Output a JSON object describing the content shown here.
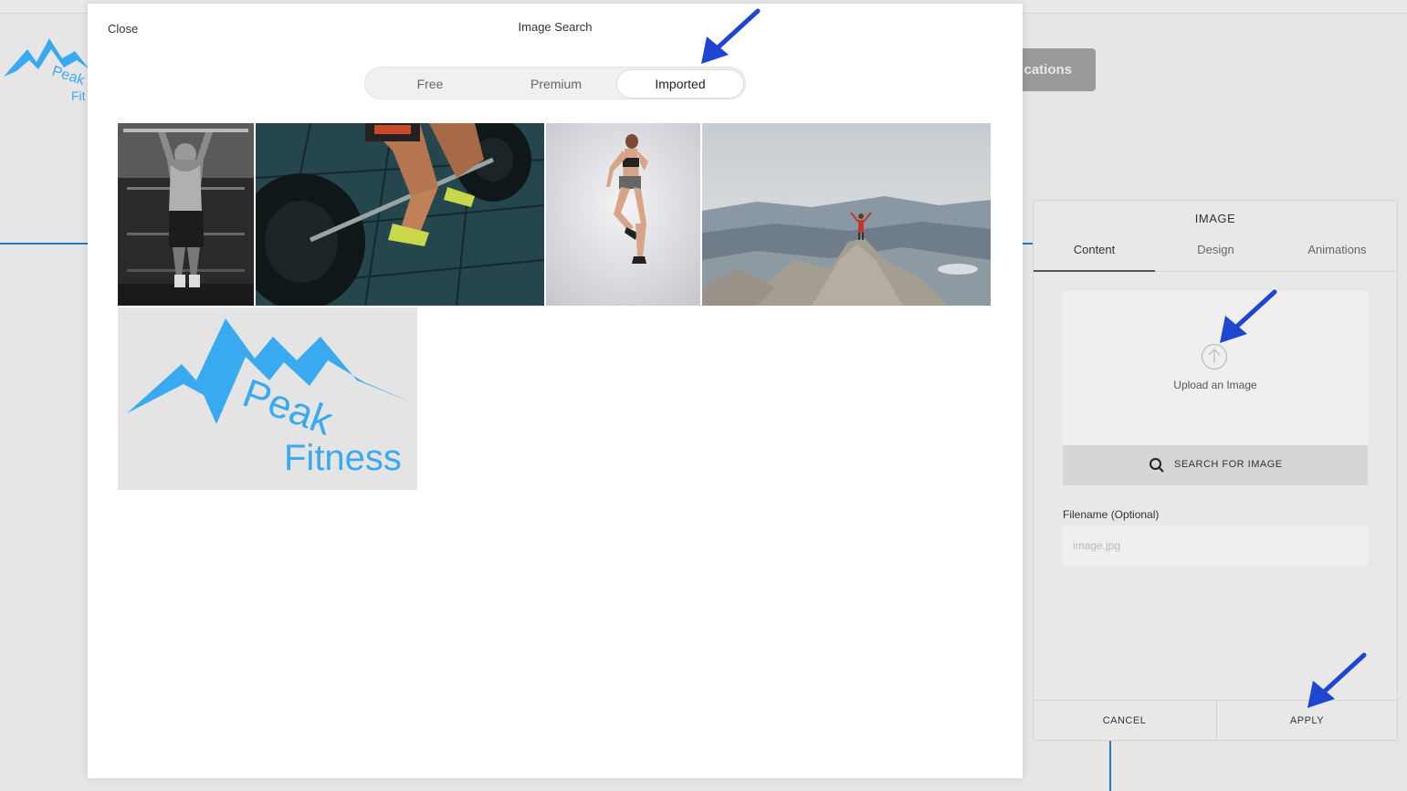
{
  "background": {
    "button_label": "cations",
    "logo_text": [
      "Peak",
      "Fit"
    ]
  },
  "modal": {
    "close_label": "Close",
    "title": "Image Search",
    "tabs": [
      {
        "label": "Free",
        "active": false
      },
      {
        "label": "Premium",
        "active": false
      },
      {
        "label": "Imported",
        "active": true
      }
    ],
    "images": [
      {
        "description": "man doing pull-ups in black and white"
      },
      {
        "description": "person lifting barbell"
      },
      {
        "description": "woman jumping in sportswear"
      },
      {
        "description": "person on mountain summit"
      },
      {
        "description": "Peak Fitness logo",
        "logo_text": [
          "Peak",
          "Fitness"
        ]
      }
    ]
  },
  "panel": {
    "title": "IMAGE",
    "tabs": [
      "Content",
      "Design",
      "Animations"
    ],
    "active_tab": "Content",
    "upload_label": "Upload an Image",
    "search_label": "SEARCH FOR IMAGE",
    "filename_label": "Filename (Optional)",
    "filename_placeholder": "image.jpg",
    "filename_value": "",
    "cancel_label": "CANCEL",
    "apply_label": "APPLY"
  },
  "colors": {
    "arrow": "#1f46d0",
    "logo_blue": "#3aaaf0",
    "accent_line": "#2a78c2"
  }
}
